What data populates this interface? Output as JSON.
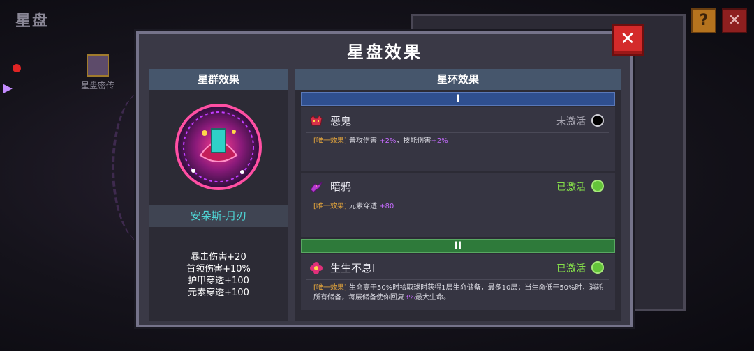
{
  "background": {
    "title": "星盘",
    "sidebar_item_label": "星盘密传"
  },
  "modal": {
    "title": "星盘效果",
    "close_glyph": "✕"
  },
  "cluster": {
    "header": "星群效果",
    "name": "安朵斯-月刃",
    "stats": [
      "暴击伤害+20",
      "首领伤害+10%",
      "护甲穿透+100",
      "元素穿透+100"
    ]
  },
  "ring": {
    "header": "星环效果",
    "tiers": [
      {
        "label": "I",
        "effects": [
          {
            "name": "恶鬼",
            "status": "未激活",
            "active": false,
            "icon": "demon-icon",
            "tag": "[唯一效果]",
            "desc": [
              {
                "t": "普攻伤害 "
              },
              {
                "t": "+2%",
                "hl": true
              },
              {
                "t": "，技能伤害"
              },
              {
                "t": "+2%",
                "hl": true
              }
            ]
          },
          {
            "name": "暗鸦",
            "status": "已激活",
            "active": true,
            "icon": "raven-icon",
            "tag": "[唯一效果]",
            "desc": [
              {
                "t": "元素穿透 "
              },
              {
                "t": "+80",
                "hl": true
              }
            ]
          }
        ]
      },
      {
        "label": "II",
        "effects": [
          {
            "name": "生生不息Ⅰ",
            "status": "已激活",
            "active": true,
            "icon": "flower-icon",
            "tag": "[唯一效果]",
            "desc": [
              {
                "t": "生命高于50%时拾取球时获得1层生命储备，最多10层；当生命低于50%时，消耗所有储备，每层储备使你回复"
              },
              {
                "t": "3%",
                "hl": true
              },
              {
                "t": "最大生命。"
              }
            ]
          }
        ]
      }
    ]
  },
  "colors": {
    "accent_cyan": "#4fd8d8",
    "active_green": "#86e04a",
    "tag_orange": "#e2a43c",
    "highlight_purple": "#c66cff",
    "tier1_blue": "#2f4f8f",
    "tier2_green": "#2e7a3a",
    "close_red": "#d42a2a"
  }
}
